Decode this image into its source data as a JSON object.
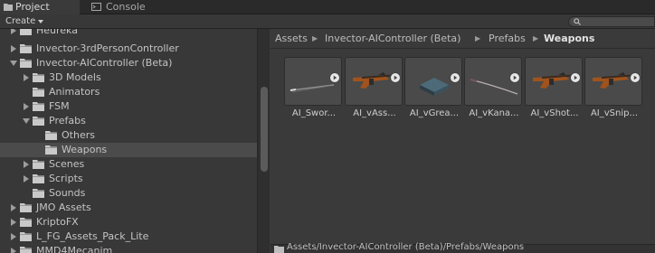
{
  "tabs": [
    {
      "label": "Project",
      "icon": "folder-icon"
    },
    {
      "label": "Console",
      "icon": "console-icon"
    }
  ],
  "toolbar": {
    "create_label": "Create",
    "create_icon": "dropdown-arrow-icon",
    "search_icon": "search-icon"
  },
  "tree": {
    "items": [
      {
        "label": "Heureka",
        "expanded": false
      },
      {
        "label": "Invector-3rdPersonController",
        "expanded": false
      },
      {
        "label": "Invector-AIController (Beta)",
        "expanded": true
      },
      {
        "label": "3D Models",
        "expanded": false
      },
      {
        "label": "Animators",
        "expanded": false
      },
      {
        "label": "FSM",
        "expanded": false
      },
      {
        "label": "Prefabs",
        "expanded": true
      },
      {
        "label": "Others",
        "expanded": false
      },
      {
        "label": "Weapons",
        "expanded": false,
        "selected": true
      },
      {
        "label": "Scenes",
        "expanded": false
      },
      {
        "label": "Scripts",
        "expanded": false
      },
      {
        "label": "Sounds",
        "expanded": false
      },
      {
        "label": "JMO Assets",
        "expanded": false
      },
      {
        "label": "KriptoFX",
        "expanded": false
      },
      {
        "label": "L_FG_Assets_Pack_Lite",
        "expanded": false
      },
      {
        "label": "MMD4Mecanim",
        "expanded": false
      }
    ]
  },
  "breadcrumb": [
    "Assets",
    "Invector-AIController (Beta)",
    "Prefabs",
    "Weapons"
  ],
  "assets": [
    {
      "name": "AI_Swor...",
      "kind": "sword"
    },
    {
      "name": "AI_vAss...",
      "kind": "rifle"
    },
    {
      "name": "AI_vGrea...",
      "kind": "box"
    },
    {
      "name": "AI_vKana...",
      "kind": "katana"
    },
    {
      "name": "AI_vShot...",
      "kind": "rifle"
    },
    {
      "name": "AI_vSnip...",
      "kind": "rifle"
    }
  ],
  "footer_path": "Assets/Invector-AIController (Beta)/Prefabs/Weapons",
  "colors": {
    "folder": "#c9c9c9",
    "selected_row": "#4b4b4b",
    "panel": "#3a3a3a"
  }
}
